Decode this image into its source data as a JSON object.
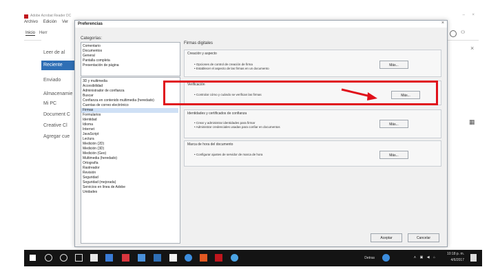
{
  "app": {
    "title": "Adobe Acrobat Reader DC",
    "menu": [
      "Archivo",
      "Edición",
      "Ver"
    ],
    "tabs": [
      "Inicio",
      "Herr"
    ],
    "sidebar": [
      "Leer de al",
      "Reciente",
      "Enviado",
      "Almacenamie",
      "Mi PC",
      "Document C",
      "Creative Cl",
      "Agregar cue"
    ],
    "right_icons": [
      "help-icon",
      "account-icon",
      "close-icon",
      "grid-icon"
    ]
  },
  "dialog": {
    "title": "Preferencias",
    "close": "×",
    "categories_label": "Categorías:",
    "categories_top": [
      "Comentario",
      "Documentos",
      "General",
      "Pantalla completa",
      "Presentación de página"
    ],
    "categories_main": [
      "3D y multimedia",
      "Accesibilidad",
      "Administrador de confianza",
      "Buscar",
      "Confianza en contenido multimedia (heredado)",
      "Cuentas de correo electrónico",
      "Firmas",
      "Formularios",
      "Identidad",
      "Idioma",
      "Internet",
      "JavaScript",
      "Lectura",
      "Medición (2D)",
      "Medición (3D)",
      "Medición (Geo)",
      "Multimedia (heredado)",
      "Ortografía",
      "Rastreador",
      "Revisión",
      "Seguridad",
      "Seguridad (mejorada)",
      "Servicios en línea de Adobe",
      "Unidades"
    ],
    "selected_category": "Firmas",
    "panel_title": "Firmas digitales",
    "groups": [
      {
        "title": "Creación y aspecto",
        "lines": [
          "• Opciones de control de creación de firma",
          "• Establecer el aspecto de las firmas en un documento"
        ],
        "button": "Más..."
      },
      {
        "title": "Verificación",
        "lines": [
          "• Controlar cómo y cuándo se verifican las firmas"
        ],
        "button": "Más..."
      },
      {
        "title": "Identidades y certificados de confianza",
        "lines": [
          "• Crear y administrar identidades para firmar",
          "• Administrar credenciales usadas para confiar en documentos"
        ],
        "button": "Más..."
      },
      {
        "title": "Marca de hora del documento",
        "lines": [
          "• Configurar ajustes de servidor de marca de hora"
        ],
        "button": "Más..."
      }
    ],
    "ok": "Aceptar",
    "cancel": "Cancelar"
  },
  "taskbar": {
    "tray_text": "Detras",
    "time": "10:18 p. m.",
    "date": "4/6/2017"
  },
  "colors": {
    "highlight": "#e0101a",
    "selected_sidebar": "#2f6fb5"
  }
}
